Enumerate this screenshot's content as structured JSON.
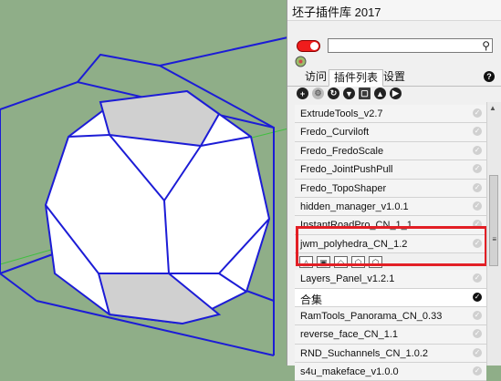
{
  "panel": {
    "title": "坯子插件库 2017",
    "search": {
      "value": "",
      "placeholder": ""
    },
    "tabs": [
      "访问",
      "插件列表",
      "设置"
    ],
    "active_tab": 1,
    "help_label": "?",
    "toolbar_icons": [
      "add-icon",
      "gear-icon",
      "refresh-icon",
      "download-icon",
      "folder-icon",
      "upload-icon",
      "forward-icon"
    ],
    "plugins": [
      {
        "name": "ExtrudeTools_v2.7"
      },
      {
        "name": "Fredo_Curviloft"
      },
      {
        "name": "Fredo_FredoScale"
      },
      {
        "name": "Fredo_JointPushPull"
      },
      {
        "name": "Fredo_TopoShaper"
      },
      {
        "name": "hidden_manager_v1.0.1"
      },
      {
        "name": "InstantRoadPro_CN_1_1"
      },
      {
        "name": "jwm_polyhedra_CN_1.2",
        "expanded": true
      },
      {
        "name": "Layers_Panel_v1.2.1"
      },
      {
        "name": "合集",
        "group": true
      },
      {
        "name": "RamTools_Panorama_CN_0.33"
      },
      {
        "name": "reverse_face_CN_1.1"
      },
      {
        "name": "RND_Suchannels_CN_1.0.2"
      },
      {
        "name": "s4u_makeface_v1.0.0"
      }
    ],
    "expanded_tool_icons": [
      "tetrahedron-icon",
      "cube-icon",
      "octahedron-icon",
      "dodecahedron-icon",
      "icosahedron-icon"
    ]
  },
  "colors": {
    "viewport_bg": "#8fae88",
    "edge_blue": "#1c1cd6",
    "highlight_red": "#e21f25",
    "toggle_red": "#ef1c1c"
  }
}
